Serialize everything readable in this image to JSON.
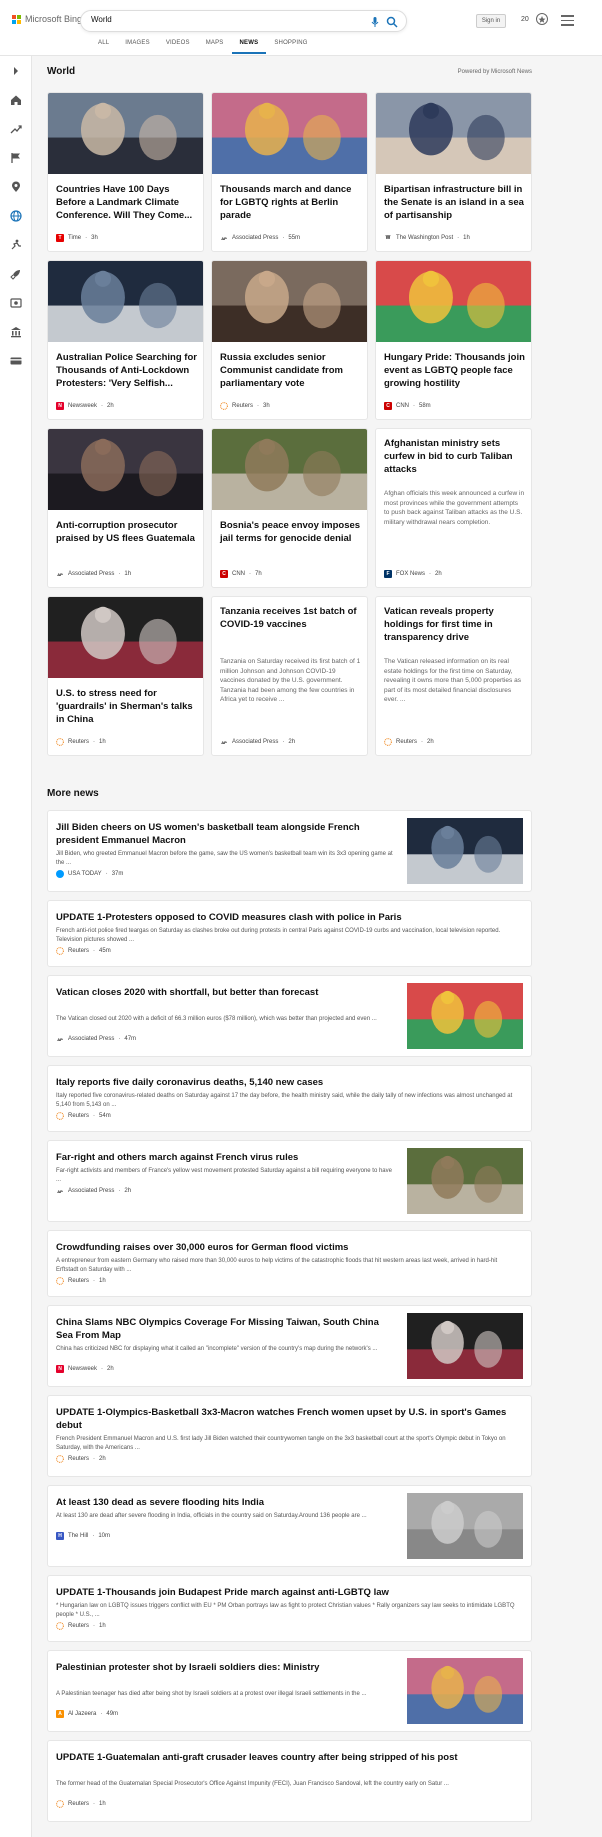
{
  "brand": {
    "name": "Microsoft Bing"
  },
  "search": {
    "value": "World"
  },
  "header": {
    "sign_in": "Sign in",
    "points": "20"
  },
  "tabs": [
    "ALL",
    "IMAGES",
    "VIDEOS",
    "MAPS",
    "NEWS",
    "SHOPPING"
  ],
  "active_tab": "NEWS",
  "section": {
    "title": "World",
    "powered_by": "Powered by Microsoft News"
  },
  "top_cards": [
    {
      "title": "Countries Have 100 Days Before a Landmark Climate Conference. Will They Come...",
      "source": "Time",
      "time": "3h",
      "has_image": true
    },
    {
      "title": "Thousands march and dance for LGBTQ rights at Berlin parade",
      "source": "Associated Press",
      "time": "55m",
      "has_image": true
    },
    {
      "title": "Bipartisan infrastructure bill in the Senate is an island in a sea of partisanship",
      "source": "The Washington Post",
      "time": "1h",
      "has_image": true
    },
    {
      "title": "Australian Police Searching for Thousands of Anti-Lockdown Protesters: 'Very Selfish...",
      "source": "Newsweek",
      "time": "2h",
      "has_image": true
    },
    {
      "title": "Russia excludes senior Communist candidate from parliamentary vote",
      "source": "Reuters",
      "time": "3h",
      "has_image": true
    },
    {
      "title": "Hungary Pride: Thousands join event as LGBTQ people face growing hostility",
      "source": "CNN",
      "time": "58m",
      "has_image": true
    },
    {
      "title": "Anti-corruption prosecutor praised by US flees Guatemala",
      "source": "Associated Press",
      "time": "1h",
      "has_image": true
    },
    {
      "title": "Bosnia's peace envoy imposes jail terms for genocide denial",
      "source": "CNN",
      "time": "7h",
      "has_image": true
    },
    {
      "title": "Afghanistan ministry sets curfew in bid to curb Taliban attacks",
      "snippet": "Afghan officials this week announced a curfew in most provinces while the government attempts to push back against Taliban attacks as the U.S. military withdrawal nears completion.",
      "source": "FOX News",
      "time": "2h",
      "has_image": false
    },
    {
      "title": "U.S. to stress need for 'guardrails' in Sherman's talks in China",
      "source": "Reuters",
      "time": "1h",
      "has_image": true
    },
    {
      "title": "Tanzania receives 1st batch of COVID-19 vaccines",
      "snippet": "Tanzania on Saturday received its first batch of 1 million Johnson and Johnson COVID-19 vaccines donated by the U.S. government. Tanzania had been among the few countries in Africa yet to receive ...",
      "source": "Associated Press",
      "time": "2h",
      "has_image": false
    },
    {
      "title": "Vatican reveals property holdings for first time in transparency drive",
      "snippet": "The Vatican released information on its real estate holdings for the first time on Saturday, revealing it owns more than 5,000 properties as part of its most detailed financial disclosures ever. ...",
      "source": "Reuters",
      "time": "2h",
      "has_image": false
    }
  ],
  "more_news": {
    "title": "More news",
    "items": [
      {
        "title": "Jill Biden cheers on US women's basketball team alongside French president Emmanuel Macron",
        "snippet": "Jill Biden, who greeted Emmanuel Macron before the game, saw the US women's basketball team win its 3x3 opening game at the ...",
        "source": "USA TODAY",
        "time": "37m",
        "has_image": true
      },
      {
        "title": "UPDATE 1-Protesters opposed to COVID measures clash with police in Paris",
        "snippet": "French anti-riot police fired teargas on Saturday as clashes broke out during protests in central Paris against COVID-19 curbs and vaccination, local television reported. Television pictures showed ...",
        "source": "Reuters",
        "time": "45m",
        "has_image": false
      },
      {
        "title": "Vatican closes 2020 with shortfall, but better than forecast",
        "snippet": "The Vatican closed out 2020 with a deficit of 66.3 million euros ($78 million), which was better than projected and even ...",
        "source": "Associated Press",
        "time": "47m",
        "has_image": true
      },
      {
        "title": "Italy reports five daily coronavirus deaths, 5,140 new cases",
        "snippet": "Italy reported five coronavirus-related deaths on Saturday against 17 the day before, the health ministry said, while the daily tally of new infections was almost unchanged at 5,140 from 5,143 on ...",
        "source": "Reuters",
        "time": "54m",
        "has_image": false
      },
      {
        "title": "Far-right and others march against French virus rules",
        "snippet": "Far-right activists and members of France's yellow vest movement protested Saturday against a bill requiring everyone to have ...",
        "source": "Associated Press",
        "time": "2h",
        "has_image": true
      },
      {
        "title": "Crowdfunding raises over 30,000 euros for German flood victims",
        "snippet": "A entrepreneur from eastern Germany who raised more than 30,000 euros to help victims of the catastrophic floods that hit western areas last week, arrived in hard-hit Erftstadt on Saturday with ...",
        "source": "Reuters",
        "time": "1h",
        "has_image": false
      },
      {
        "title": "China Slams NBC Olympics Coverage For Missing Taiwan, South China Sea From Map",
        "snippet": "China has criticized NBC for displaying what it called an \"incomplete\" version of the country's map during the network's ...",
        "source": "Newsweek",
        "time": "2h",
        "has_image": true
      },
      {
        "title": "UPDATE 1-Olympics-Basketball 3x3-Macron watches French women upset by U.S. in sport's Games debut",
        "snippet": "French President Emmanuel Macron and U.S. first lady Jill Biden watched their countrywomen tangle on the 3x3 basketball court at the sport's Olympic debut in Tokyo on Saturday, with the Americans ...",
        "source": "Reuters",
        "time": "2h",
        "has_image": false
      },
      {
        "title": "At least 130 dead as severe flooding hits India",
        "snippet": "At least 130 are dead after severe flooding in India, officials in the country said on Saturday.Around 136 people are ...",
        "source": "The Hill",
        "time": "10m",
        "has_image": true
      },
      {
        "title": "UPDATE 1-Thousands join Budapest Pride march against anti-LGBTQ law",
        "snippet": "* Hungarian law on LGBTQ issues triggers conflict with EU * PM Orban portrays law as fight to protect Christian values * Rally organizers say law seeks to intimidate LGBTQ people * U.S., ...",
        "source": "Reuters",
        "time": "1h",
        "has_image": false
      },
      {
        "title": "Palestinian protester shot by Israeli soldiers dies: Ministry",
        "snippet": "A Palestinian teenager has died after being shot by Israeli soldiers at a protest over illegal Israeli settlements in the ...",
        "source": "Al Jazeera",
        "time": "49m",
        "has_image": true
      },
      {
        "title": "UPDATE 1-Guatemalan anti-graft crusader leaves country after being stripped of his post",
        "snippet": "The former head of the Guatemalan Special Prosecutor's Office Against Impunity (FECI), Juan Francisco Sandoval, left the country early on Satur ...",
        "source": "Reuters",
        "time": "1h",
        "has_image": false
      }
    ]
  },
  "colors": {
    "accent": "#1a73b8",
    "ms_red": "#f25022",
    "ms_green": "#7fba00",
    "ms_blue": "#00a4ef",
    "ms_yellow": "#ffb900"
  }
}
